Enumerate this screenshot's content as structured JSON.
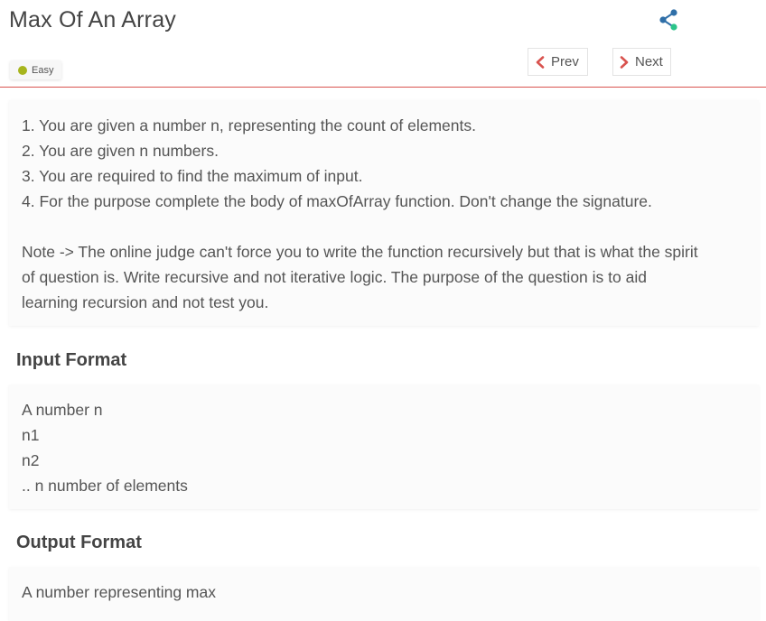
{
  "header": {
    "title": "Max Of An Array",
    "difficulty": "Easy",
    "difficulty_color": "#a7b51d",
    "prev_label": "Prev",
    "next_label": "Next",
    "share_icon": "share-icon",
    "accent_color": "#d9534f"
  },
  "description": {
    "steps": [
      "1. You are given a number n, representing the count of elements.",
      "2. You are given n numbers.",
      "3. You are required to find the maximum of input.",
      "4. For the purpose complete the body of maxOfArray function. Don't change the signature."
    ],
    "note_lines": [
      "Note -> The online judge can't force you to write the function recursively but that is what the spirit",
      "of question is. Write recursive and not iterative logic. The purpose of the question is to aid",
      "learning recursion and not test you."
    ]
  },
  "input_format": {
    "heading": "Input Format",
    "lines": [
      "A number n",
      "n1",
      "n2",
      ".. n number of elements"
    ]
  },
  "output_format": {
    "heading": "Output Format",
    "lines": [
      "A number representing max"
    ]
  }
}
